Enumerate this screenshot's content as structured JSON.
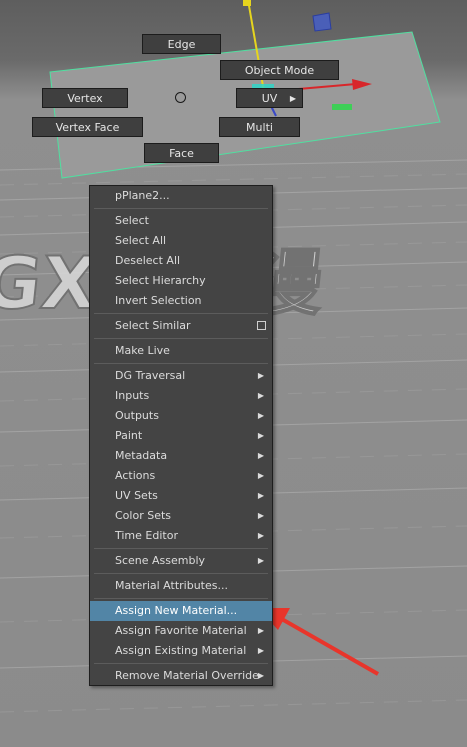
{
  "marking_menu": {
    "edge": "Edge",
    "object_mode": "Object Mode",
    "vertex": "Vertex",
    "uv": "UV",
    "vertex_face": "Vertex Face",
    "multi": "Multi",
    "face": "Face"
  },
  "context_menu": {
    "header": "pPlane2...",
    "items": [
      {
        "label": "Select"
      },
      {
        "label": "Select All"
      },
      {
        "label": "Deselect All"
      },
      {
        "label": "Select Hierarchy"
      },
      {
        "label": "Invert Selection"
      },
      {
        "label": "Select Similar",
        "option_box": true
      },
      {
        "label": "Make Live"
      },
      {
        "label": "DG Traversal",
        "submenu": true
      },
      {
        "label": "Inputs",
        "submenu": true
      },
      {
        "label": "Outputs",
        "submenu": true
      },
      {
        "label": "Paint",
        "submenu": true
      },
      {
        "label": "Metadata",
        "submenu": true
      },
      {
        "label": "Actions",
        "submenu": true
      },
      {
        "label": "UV Sets",
        "submenu": true
      },
      {
        "label": "Color Sets",
        "submenu": true
      },
      {
        "label": "Time Editor",
        "submenu": true
      },
      {
        "label": "Scene Assembly",
        "submenu": true
      },
      {
        "label": "Material Attributes..."
      },
      {
        "label": "Assign New Material...",
        "highlighted": true
      },
      {
        "label": "Assign Favorite Material",
        "submenu": true
      },
      {
        "label": "Assign Existing Material",
        "submenu": true
      },
      {
        "label": "Remove Material Override",
        "submenu": true
      }
    ]
  },
  "watermark": "GXIX动漫",
  "colors": {
    "highlight": "#5285a6",
    "menu_bg": "#444444",
    "plane_outline": "#4fe0a0",
    "arrow": "#e8352b"
  }
}
